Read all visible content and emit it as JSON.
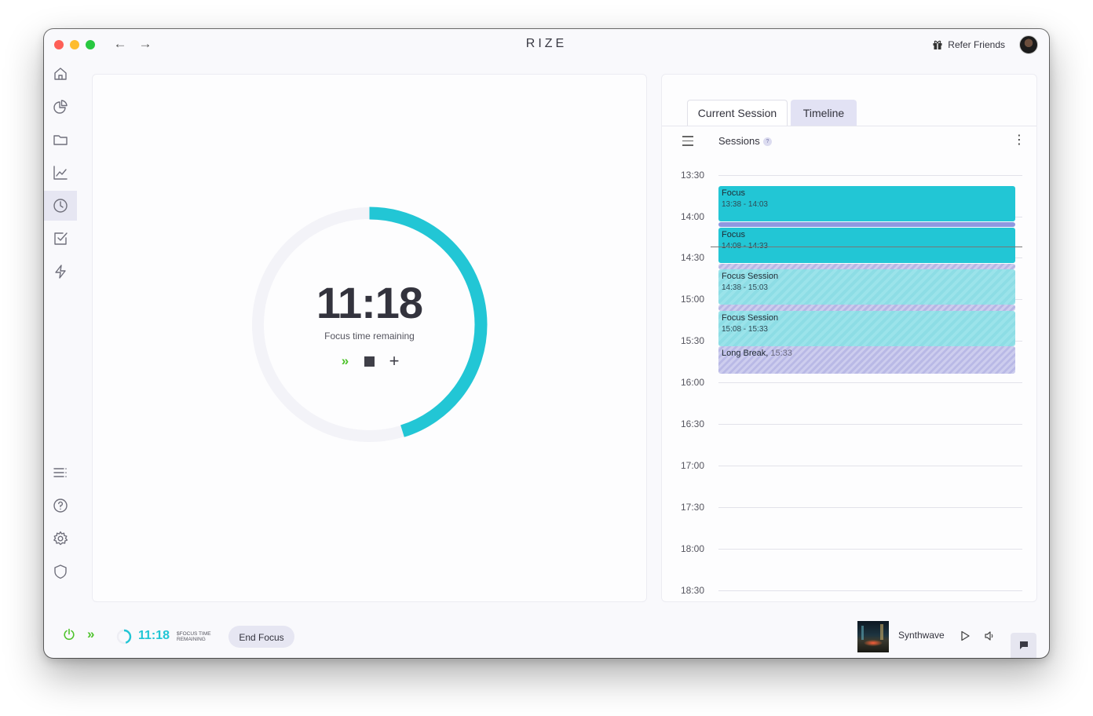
{
  "app": {
    "title": "RIZE",
    "refer_label": "Refer Friends"
  },
  "nav": {
    "back_icon": "arrow-left-icon",
    "forward_icon": "arrow-right-icon"
  },
  "sidebar": {
    "top_items": [
      "home-icon",
      "pie-chart-icon",
      "folder-icon",
      "trend-chart-icon",
      "clock-icon",
      "checkbox-icon",
      "lightning-icon"
    ],
    "active_item": "clock-icon",
    "bottom_items": [
      "list-icon",
      "help-icon",
      "settings-icon",
      "shield-icon"
    ]
  },
  "timer": {
    "time": "11:18",
    "subtitle": "Focus time remaining",
    "progress_fraction": 0.452,
    "color": "#22c6d5"
  },
  "tabs": {
    "current_session": "Current Session",
    "timeline": "Timeline",
    "active": "timeline"
  },
  "sessions": {
    "label": "Sessions",
    "help": "?",
    "hours": [
      "13:30",
      "14:00",
      "14:30",
      "15:00",
      "15:30",
      "16:00",
      "16:30",
      "17:00",
      "17:30",
      "18:00",
      "18:30"
    ],
    "blocks": [
      {
        "title": "Focus",
        "time": "13:38 - 14:03",
        "kind": "focus"
      },
      {
        "title": "Focus",
        "time": "14:08 - 14:33",
        "kind": "focus"
      },
      {
        "title": "Focus Session",
        "time": "14:38 - 15:03",
        "kind": "session"
      },
      {
        "title": "Focus Session",
        "time": "15:08 - 15:33",
        "kind": "session"
      },
      {
        "title": "Long Break",
        "time": "15:33",
        "kind": "break"
      }
    ]
  },
  "bottom": {
    "time": "11:18",
    "sub": "$FOCUS TIME REMAINING",
    "end_label": "End Focus",
    "track": "Synthwave"
  },
  "colors": {
    "accent": "#22c6d5",
    "green": "#4ec32c",
    "break": "#b9b9e6",
    "gap": "#8e98e0"
  }
}
